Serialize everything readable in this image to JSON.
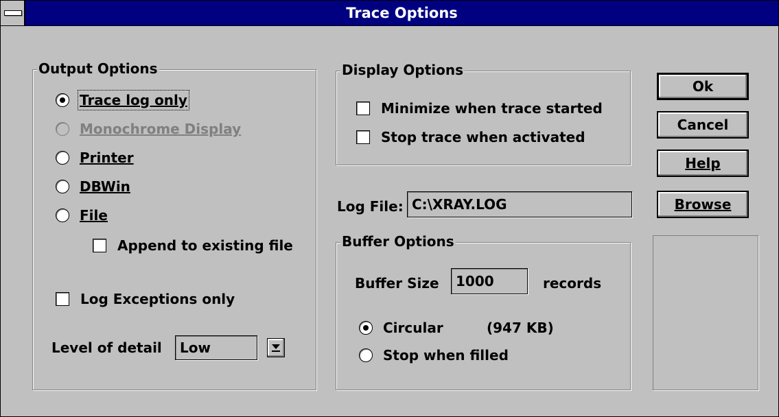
{
  "window": {
    "title": "Trace Options"
  },
  "output_options": {
    "label": "Output Options",
    "radios": [
      {
        "label": "Trace log only",
        "selected": true,
        "enabled": true
      },
      {
        "label": "Monochrome Display",
        "selected": false,
        "enabled": false
      },
      {
        "label": "Printer",
        "selected": false,
        "enabled": true
      },
      {
        "label": "DBWin",
        "selected": false,
        "enabled": true
      },
      {
        "label": "File",
        "selected": false,
        "enabled": true
      }
    ],
    "append_label": "Append to existing file",
    "append_checked": false,
    "log_exceptions_label": "Log Exceptions only",
    "log_exceptions_checked": false,
    "level_label": "Level of detail",
    "level_value": "Low"
  },
  "display_options": {
    "label": "Display Options",
    "minimize_label": "Minimize when trace started",
    "minimize_checked": false,
    "stop_label": "Stop trace when activated",
    "stop_checked": false
  },
  "log_file": {
    "label": "Log File:",
    "value": "C:\\XRAY.LOG"
  },
  "buffer_options": {
    "label": "Buffer Options",
    "size_label": "Buffer Size",
    "size_value": "1000",
    "unit": "records",
    "circular_label": "Circular",
    "circular_selected": true,
    "kb_text": "(947 KB)",
    "stop_filled_label": "Stop when filled",
    "stop_filled_selected": false
  },
  "buttons": {
    "ok": "Ok",
    "cancel": "Cancel",
    "help": "Help",
    "browse": "Browse"
  },
  "colors": {
    "title_bar": "#000080",
    "face": "#c0c0c0",
    "shadow": "#808080"
  }
}
